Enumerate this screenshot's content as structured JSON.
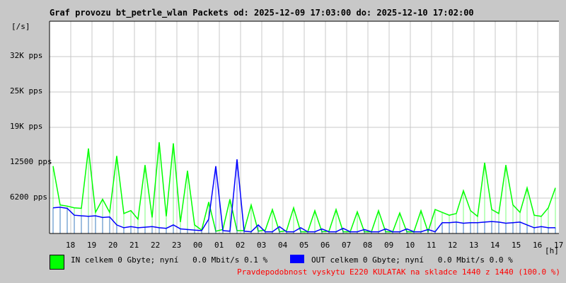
{
  "chart_data": {
    "type": "line",
    "title": "Graf provozu bt_petrle_wlan Packets od: 2025-12-09 17:03:00 do: 2025-12-10 17:02:00",
    "ylabel": "[/s]",
    "xlabel": "[h]",
    "ylim": [
      0,
      37200
    ],
    "ytick_labels": [
      "6200 pps",
      "12500 pps",
      "19K pps",
      "25K pps",
      "32K pps"
    ],
    "ytick_values": [
      6200,
      12500,
      18600,
      24800,
      31000
    ],
    "xtick_labels": [
      "18",
      "19",
      "20",
      "21",
      "22",
      "23",
      "00",
      "01",
      "02",
      "03",
      "04",
      "05",
      "06",
      "07",
      "08",
      "09",
      "10",
      "11",
      "12",
      "13",
      "14",
      "15",
      "16",
      "17"
    ],
    "grid": true,
    "points_per_hour": 3,
    "series": [
      {
        "name": "IN",
        "color": "#00ff00",
        "values": [
          11800,
          5000,
          4800,
          4500,
          4400,
          14900,
          3700,
          6000,
          3700,
          13600,
          3500,
          4000,
          2500,
          12000,
          2800,
          16000,
          3000,
          15800,
          2000,
          11000,
          1500,
          600,
          5500,
          400,
          700,
          6000,
          500,
          500,
          5000,
          400,
          600,
          4200,
          300,
          500,
          4500,
          300,
          300,
          4000,
          300,
          400,
          4200,
          300,
          300,
          3800,
          300,
          300,
          4000,
          300,
          300,
          3600,
          300,
          300,
          4000,
          300,
          4200,
          3700,
          3200,
          3500,
          7500,
          4000,
          3000,
          12400,
          4200,
          3500,
          12000,
          5000,
          3700,
          8000,
          3200,
          3000,
          4500,
          8000
        ]
      },
      {
        "name": "OUT",
        "color": "#0000ff",
        "values": [
          4500,
          4600,
          4400,
          3200,
          3100,
          3000,
          3100,
          2800,
          2900,
          1500,
          1000,
          1200,
          1000,
          1100,
          1200,
          1000,
          900,
          1500,
          800,
          700,
          600,
          500,
          2500,
          11800,
          500,
          400,
          13000,
          400,
          300,
          1500,
          300,
          300,
          1200,
          300,
          300,
          1000,
          300,
          300,
          800,
          300,
          300,
          900,
          300,
          300,
          700,
          300,
          300,
          800,
          300,
          300,
          800,
          300,
          300,
          700,
          300,
          1900,
          1900,
          2000,
          1800,
          1900,
          1900,
          2000,
          2100,
          2000,
          1800,
          1900,
          2000,
          1500,
          1000,
          1200,
          1000,
          1000
        ]
      }
    ]
  },
  "legend": {
    "in_text": "IN celkem 0 Gbyte; nyní   0.0 Mbit/s 0.1 %",
    "out_text": "OUT celkem 0 Gbyte; nyní   0.0 Mbit/s 0.0 %"
  },
  "warning": "Pravdepodobnost vyskytu E220 KULATAK na skladce 1440 z 1440 (100.0 %)"
}
